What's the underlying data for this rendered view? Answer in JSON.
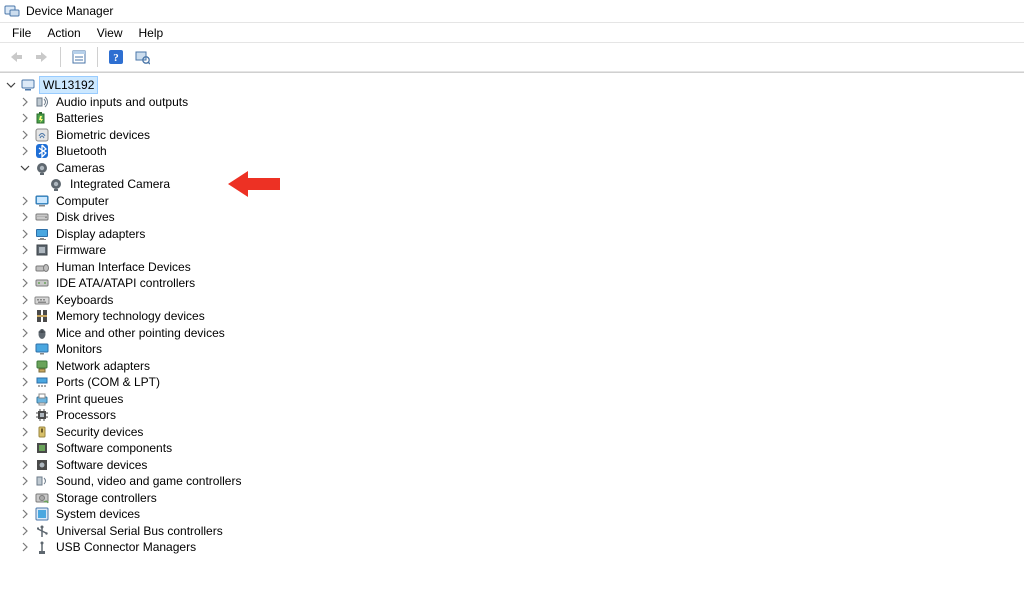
{
  "window": {
    "title": "Device Manager"
  },
  "menu": {
    "file": "File",
    "action": "Action",
    "view": "View",
    "help": "Help"
  },
  "root": {
    "label": "WL13192"
  },
  "categories": [
    {
      "icon": "audio",
      "label": "Audio inputs and outputs"
    },
    {
      "icon": "battery",
      "label": "Batteries"
    },
    {
      "icon": "biometric",
      "label": "Biometric devices"
    },
    {
      "icon": "bluetooth",
      "label": "Bluetooth"
    },
    {
      "icon": "camera",
      "label": "Cameras",
      "expanded": true,
      "children": [
        {
          "icon": "camera",
          "label": "Integrated Camera"
        }
      ]
    },
    {
      "icon": "computer",
      "label": "Computer"
    },
    {
      "icon": "diskdrive",
      "label": "Disk drives"
    },
    {
      "icon": "display",
      "label": "Display adapters"
    },
    {
      "icon": "firmware",
      "label": "Firmware"
    },
    {
      "icon": "hid",
      "label": "Human Interface Devices"
    },
    {
      "icon": "ide",
      "label": "IDE ATA/ATAPI controllers"
    },
    {
      "icon": "keyboard",
      "label": "Keyboards"
    },
    {
      "icon": "memory",
      "label": "Memory technology devices"
    },
    {
      "icon": "mouse",
      "label": "Mice and other pointing devices"
    },
    {
      "icon": "monitor",
      "label": "Monitors"
    },
    {
      "icon": "network",
      "label": "Network adapters"
    },
    {
      "icon": "ports",
      "label": "Ports (COM & LPT)"
    },
    {
      "icon": "printqueue",
      "label": "Print queues"
    },
    {
      "icon": "processor",
      "label": "Processors"
    },
    {
      "icon": "security",
      "label": "Security devices"
    },
    {
      "icon": "swcomp",
      "label": "Software components"
    },
    {
      "icon": "swdev",
      "label": "Software devices"
    },
    {
      "icon": "sound",
      "label": "Sound, video and game controllers"
    },
    {
      "icon": "storage",
      "label": "Storage controllers"
    },
    {
      "icon": "system",
      "label": "System devices"
    },
    {
      "icon": "usb",
      "label": "Universal Serial Bus controllers"
    },
    {
      "icon": "usbconn",
      "label": "USB Connector Managers"
    }
  ],
  "annotation": {
    "color": "#ed3124"
  }
}
